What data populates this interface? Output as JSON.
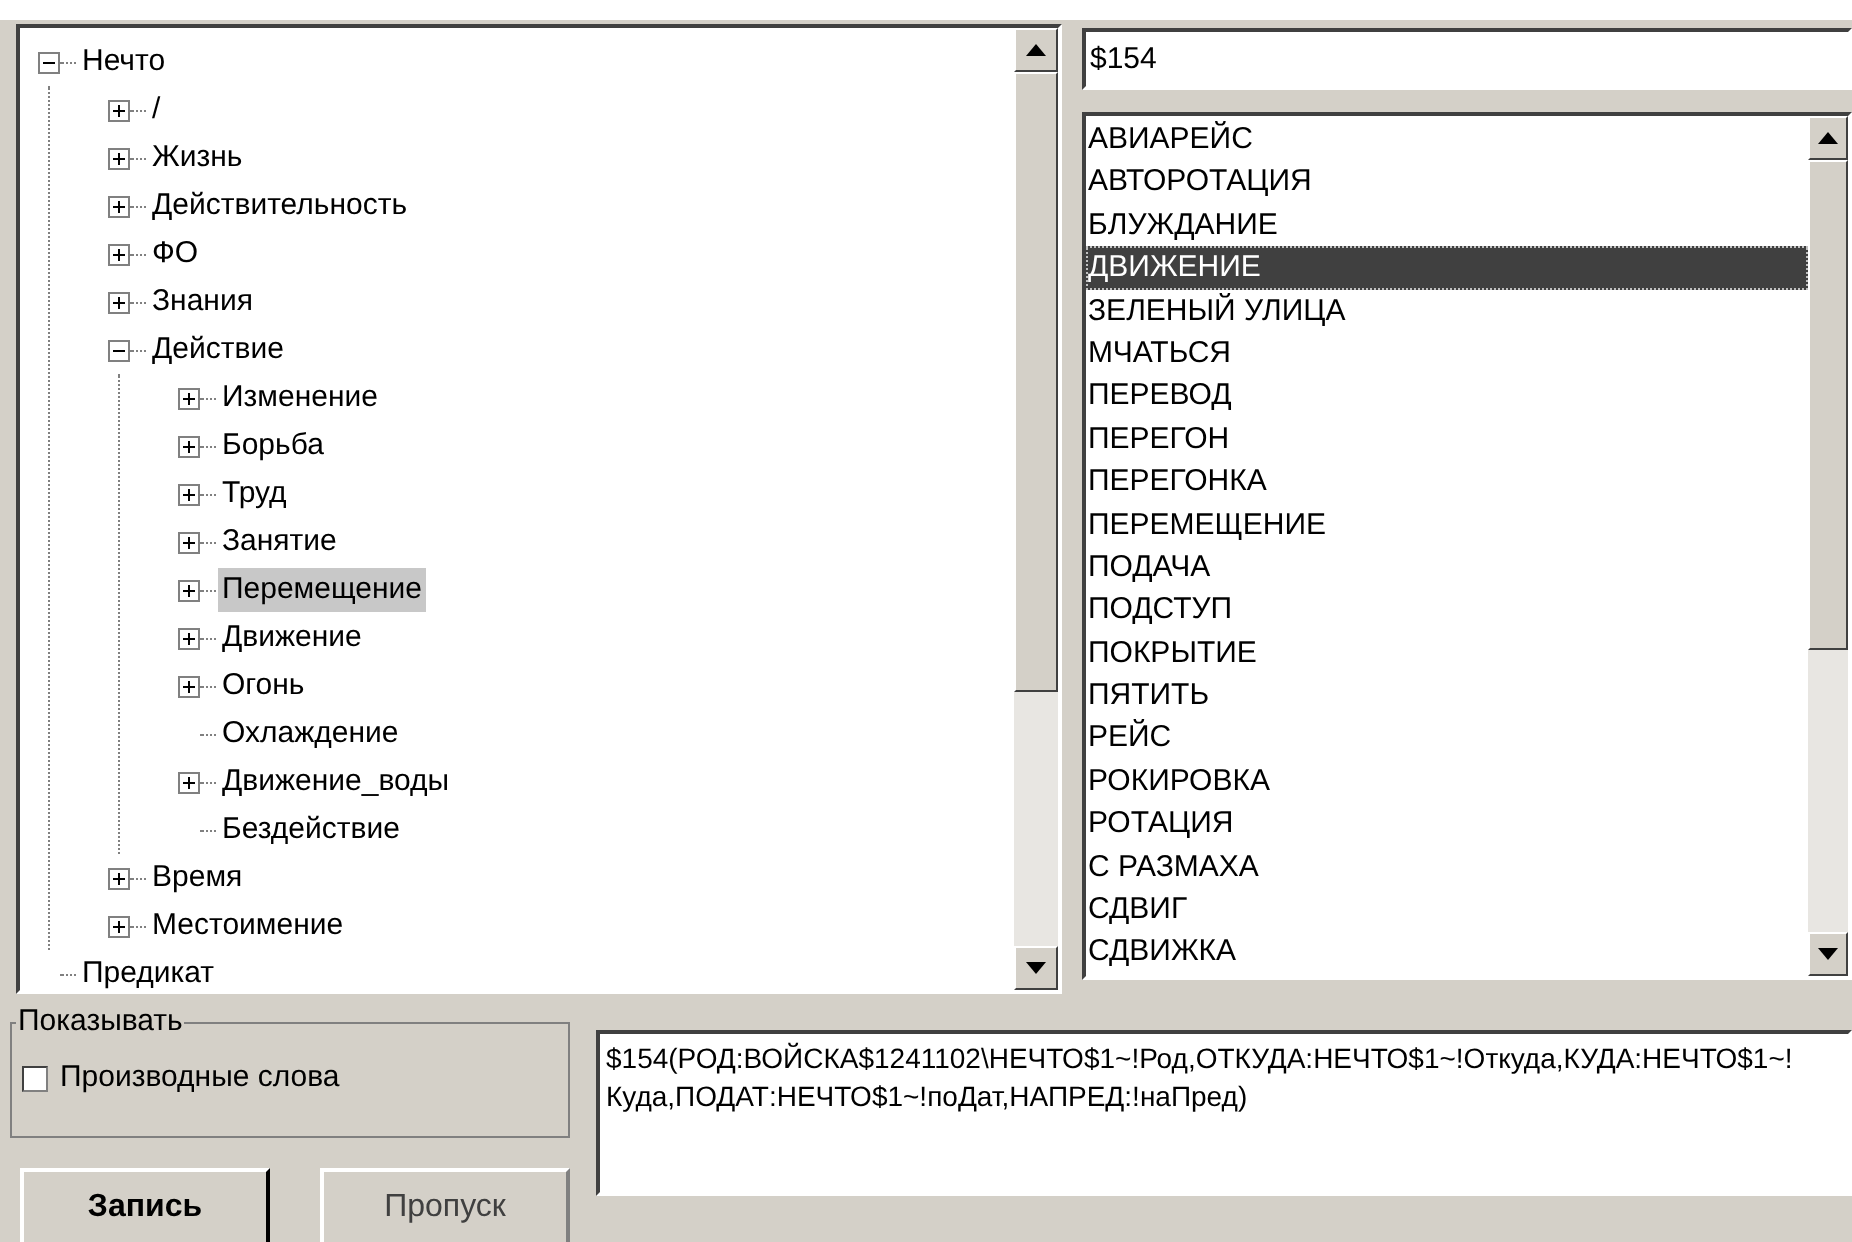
{
  "tree": {
    "items": [
      {
        "label": "Нечто",
        "kind": "folder",
        "expanded": true,
        "selected": false,
        "children": [
          {
            "label": "/",
            "kind": "folder",
            "expanded": false,
            "selected": false
          },
          {
            "label": "Жизнь",
            "kind": "folder",
            "expanded": false,
            "selected": false
          },
          {
            "label": "Действительность",
            "kind": "folder",
            "expanded": false,
            "selected": false
          },
          {
            "label": "ФО",
            "kind": "folder",
            "expanded": false,
            "selected": false
          },
          {
            "label": "Знания",
            "kind": "folder",
            "expanded": false,
            "selected": false
          },
          {
            "label": "Действие",
            "kind": "folder",
            "expanded": true,
            "selected": false,
            "children": [
              {
                "label": "Изменение",
                "kind": "folder",
                "expanded": false,
                "selected": false
              },
              {
                "label": "Борьба",
                "kind": "folder",
                "expanded": false,
                "selected": false
              },
              {
                "label": "Труд",
                "kind": "folder",
                "expanded": false,
                "selected": false
              },
              {
                "label": "Занятие",
                "kind": "folder",
                "expanded": false,
                "selected": false
              },
              {
                "label": "Перемещение",
                "kind": "folder",
                "expanded": false,
                "selected": true
              },
              {
                "label": "Движение",
                "kind": "folder",
                "expanded": false,
                "selected": false
              },
              {
                "label": "Огонь",
                "kind": "folder",
                "expanded": false,
                "selected": false
              },
              {
                "label": "Охлаждение",
                "kind": "leaf",
                "selected": false
              },
              {
                "label": "Движение_воды",
                "kind": "folder",
                "expanded": false,
                "selected": false
              },
              {
                "label": "Бездействие",
                "kind": "leaf",
                "selected": false
              }
            ]
          },
          {
            "label": "Время",
            "kind": "folder",
            "expanded": false,
            "selected": false
          },
          {
            "label": "Местоимение",
            "kind": "folder",
            "expanded": false,
            "selected": false
          }
        ]
      },
      {
        "label": "Предикат",
        "kind": "leaf",
        "selected": false
      }
    ]
  },
  "code_field": {
    "value": "$154"
  },
  "word_list": {
    "items": [
      {
        "label": "АВИАРЕЙС",
        "selected": false
      },
      {
        "label": "АВТОРОТАЦИЯ",
        "selected": false
      },
      {
        "label": "БЛУЖДАНИЕ",
        "selected": false
      },
      {
        "label": "ДВИЖЕНИЕ",
        "selected": true
      },
      {
        "label": "ЗЕЛЕНЫЙ УЛИЦА",
        "selected": false
      },
      {
        "label": "МЧАТЬСЯ",
        "selected": false
      },
      {
        "label": "ПЕРЕВОД",
        "selected": false
      },
      {
        "label": "ПЕРЕГОН",
        "selected": false
      },
      {
        "label": "ПЕРЕГОНКА",
        "selected": false
      },
      {
        "label": "ПЕРЕМЕЩЕНИЕ",
        "selected": false
      },
      {
        "label": "ПОДАЧА",
        "selected": false
      },
      {
        "label": "ПОДСТУП",
        "selected": false
      },
      {
        "label": "ПОКРЫТИЕ",
        "selected": false
      },
      {
        "label": "ПЯТИТЬ",
        "selected": false
      },
      {
        "label": "РЕЙС",
        "selected": false
      },
      {
        "label": "РОКИРОВКА",
        "selected": false
      },
      {
        "label": "РОТАЦИЯ",
        "selected": false
      },
      {
        "label": "С РАЗМАХА",
        "selected": false
      },
      {
        "label": "СДВИГ",
        "selected": false
      },
      {
        "label": "СДВИЖКА",
        "selected": false
      }
    ]
  },
  "show_group": {
    "title": "Показывать",
    "checkbox": {
      "label": "Производные слова",
      "checked": false
    }
  },
  "buttons": [
    {
      "label": "Запись",
      "default": true
    },
    {
      "label": "Пропуск",
      "default": false
    }
  ],
  "definition": {
    "value": "$154(РОД:ВОЙСКА$1241102\\НЕЧТО$1~!Род,ОТКУДА:НЕЧТО$1~!Откуда,КУДА:НЕЧТО$1~!Куда,ПОДАТ:НЕЧТО$1~!поДат,НАПРЕД:!наПред)"
  }
}
